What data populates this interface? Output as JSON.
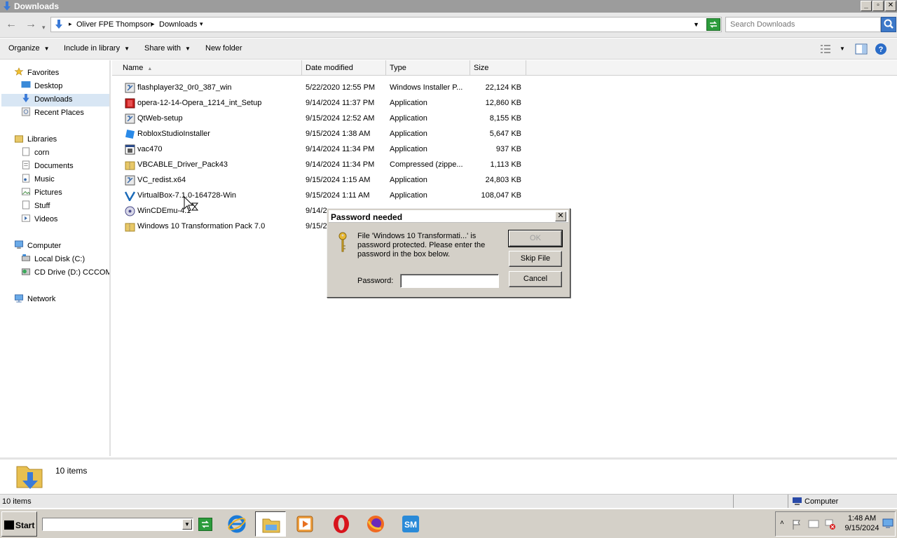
{
  "window": {
    "title": "Downloads"
  },
  "address": {
    "breadcrumbs": [
      "Oliver FPE Thompson",
      "Downloads"
    ],
    "search_placeholder": "Search Downloads"
  },
  "toolbar": {
    "organize": "Organize",
    "include_in_library": "Include in library",
    "share_with": "Share with",
    "new_folder": "New folder"
  },
  "nav": {
    "favorites": "Favorites",
    "favorites_items": [
      "Desktop",
      "Downloads",
      "Recent Places"
    ],
    "libraries": "Libraries",
    "libraries_items": [
      "corn",
      "Documents",
      "Music",
      "Pictures",
      "Stuff",
      "Videos"
    ],
    "computer": "Computer",
    "computer_items": [
      "Local Disk (C:)",
      "CD Drive (D:) CCCOMA"
    ],
    "network": "Network"
  },
  "columns": {
    "name": "Name",
    "date": "Date modified",
    "type": "Type",
    "size": "Size"
  },
  "files": [
    {
      "name": "flashplayer32_0r0_387_win",
      "date": "5/22/2020 12:55 PM",
      "type": "Windows Installer P...",
      "size": "22,124 KB"
    },
    {
      "name": "opera-12-14-Opera_1214_int_Setup",
      "date": "9/14/2024 11:37 PM",
      "type": "Application",
      "size": "12,860 KB"
    },
    {
      "name": "QtWeb-setup",
      "date": "9/15/2024 12:52 AM",
      "type": "Application",
      "size": "8,155 KB"
    },
    {
      "name": "RobloxStudioInstaller",
      "date": "9/15/2024 1:38 AM",
      "type": "Application",
      "size": "5,647 KB"
    },
    {
      "name": "vac470",
      "date": "9/14/2024 11:34 PM",
      "type": "Application",
      "size": "937 KB"
    },
    {
      "name": "VBCABLE_Driver_Pack43",
      "date": "9/14/2024 11:34 PM",
      "type": "Compressed (zippe...",
      "size": "1,113 KB"
    },
    {
      "name": "VC_redist.x64",
      "date": "9/15/2024 1:15 AM",
      "type": "Application",
      "size": "24,803 KB"
    },
    {
      "name": "VirtualBox-7.1.0-164728-Win",
      "date": "9/15/2024 1:11 AM",
      "type": "Application",
      "size": "108,047 KB"
    },
    {
      "name": "WinCDEmu-4.1",
      "date": "9/14/2",
      "type": "",
      "size": ""
    },
    {
      "name": "Windows 10 Transformation Pack 7.0",
      "date": "9/15/2",
      "type": "",
      "size": ""
    }
  ],
  "details": {
    "count": "10 items"
  },
  "statusbar": {
    "count": "10 items",
    "location": "Computer"
  },
  "dialog": {
    "title": "Password needed",
    "message": "File 'Windows 10 Transformati...' is password protected.  Please enter the password in the box below.",
    "ok": "OK",
    "skip": "Skip File",
    "cancel": "Cancel",
    "password_label": "Password:"
  },
  "taskbar": {
    "start": "Start",
    "time": "1:48 AM",
    "date": "9/15/2024",
    "apps": [
      "internet-explorer-icon",
      "file-explorer-icon",
      "media-player-icon",
      "opera-icon",
      "firefox-icon",
      "seamonkey-icon"
    ]
  },
  "colors": {
    "accent": "#3c78c8",
    "selection": "#d8e6f4",
    "dialog_face": "#d4d0c8"
  }
}
